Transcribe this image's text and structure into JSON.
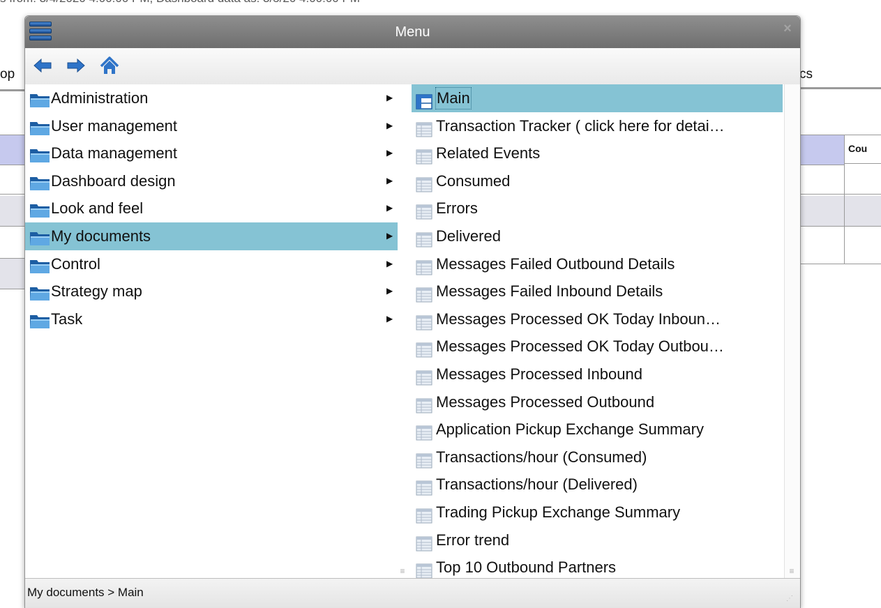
{
  "background": {
    "top_text": "s from: 3/4/2020 4:00:00 PM, Dashboard data as: 3/5/20 4:00:00 PM",
    "left_fragment": "op",
    "right_fragment": "cs",
    "table_header_fragment": "Cou"
  },
  "window": {
    "title": "Menu",
    "close_glyph": "×"
  },
  "toolbar": {
    "back_icon": "back-arrow-icon",
    "forward_icon": "forward-arrow-icon",
    "home_icon": "home-icon"
  },
  "menu": {
    "items": [
      {
        "label": "Administration",
        "selected": false
      },
      {
        "label": "User management",
        "selected": false
      },
      {
        "label": "Data management",
        "selected": false
      },
      {
        "label": "Dashboard design",
        "selected": false
      },
      {
        "label": "Look and feel",
        "selected": false
      },
      {
        "label": "My documents",
        "selected": true
      },
      {
        "label": "Control",
        "selected": false
      },
      {
        "label": "Strategy map",
        "selected": false
      },
      {
        "label": "Task",
        "selected": false
      }
    ],
    "arrow_glyph": "▶"
  },
  "documents": {
    "items": [
      {
        "label": "Main",
        "selected": true,
        "icon": "dashboard-icon"
      },
      {
        "label": "Transaction Tracker ( click here for detai…",
        "selected": false,
        "icon": "report-icon"
      },
      {
        "label": "Related Events",
        "selected": false,
        "icon": "report-icon"
      },
      {
        "label": "Consumed",
        "selected": false,
        "icon": "report-icon"
      },
      {
        "label": "Errors",
        "selected": false,
        "icon": "report-icon"
      },
      {
        "label": "Delivered",
        "selected": false,
        "icon": "report-icon"
      },
      {
        "label": "Messages Failed Outbound Details",
        "selected": false,
        "icon": "report-icon"
      },
      {
        "label": "Messages Failed Inbound Details",
        "selected": false,
        "icon": "report-icon"
      },
      {
        "label": "Messages Processed OK Today Inboun…",
        "selected": false,
        "icon": "report-icon"
      },
      {
        "label": "Messages Processed OK Today Outbou…",
        "selected": false,
        "icon": "report-icon"
      },
      {
        "label": "Messages Processed Inbound",
        "selected": false,
        "icon": "report-icon"
      },
      {
        "label": "Messages Processed Outbound",
        "selected": false,
        "icon": "report-icon"
      },
      {
        "label": "Application Pickup Exchange Summary",
        "selected": false,
        "icon": "report-icon"
      },
      {
        "label": "Transactions/hour (Consumed)",
        "selected": false,
        "icon": "report-icon"
      },
      {
        "label": "Transactions/hour (Delivered)",
        "selected": false,
        "icon": "report-icon"
      },
      {
        "label": "Trading Pickup Exchange Summary",
        "selected": false,
        "icon": "report-icon"
      },
      {
        "label": "Error trend",
        "selected": false,
        "icon": "report-icon"
      },
      {
        "label": "Top 10 Outbound Partners",
        "selected": false,
        "icon": "report-icon"
      }
    ]
  },
  "statusbar": {
    "path": "My documents > Main"
  },
  "colors": {
    "selection": "#85c3d4",
    "titlebar": "#7e7e7e",
    "folder": "#2f7fc4",
    "table_header": "#c6c9ee"
  }
}
